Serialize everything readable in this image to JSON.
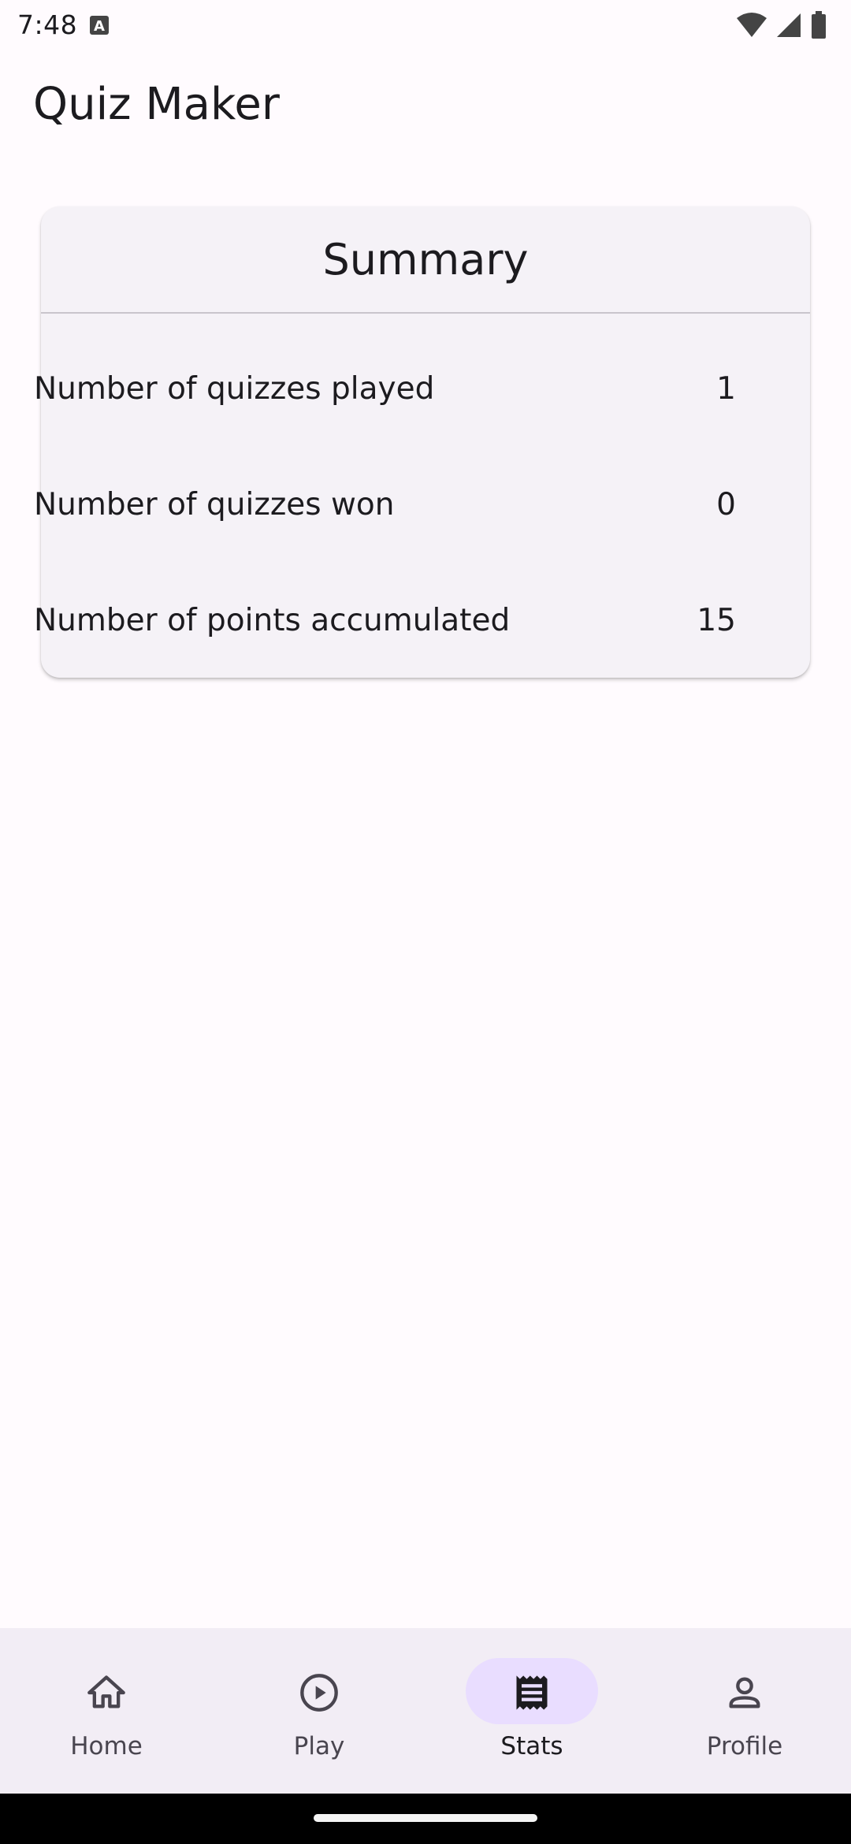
{
  "status_bar": {
    "time": "7:48"
  },
  "app_bar": {
    "title": "Quiz Maker"
  },
  "summary": {
    "title": "Summary",
    "rows": [
      {
        "label": "Number of quizzes played",
        "value": "1"
      },
      {
        "label": "Number of quizzes won",
        "value": "0"
      },
      {
        "label": "Number of points accumulated",
        "value": "15"
      }
    ]
  },
  "bottom_nav": {
    "items": [
      {
        "label": "Home",
        "icon": "home-icon"
      },
      {
        "label": "Play",
        "icon": "play-circle-icon"
      },
      {
        "label": "Stats",
        "icon": "receipt-icon",
        "active": true
      },
      {
        "label": "Profile",
        "icon": "person-icon"
      }
    ]
  },
  "colors": {
    "background": "#fffbfe",
    "card": "#f5f2f7",
    "nav_background": "#f2edf5",
    "active_pill": "#e9ddff"
  }
}
